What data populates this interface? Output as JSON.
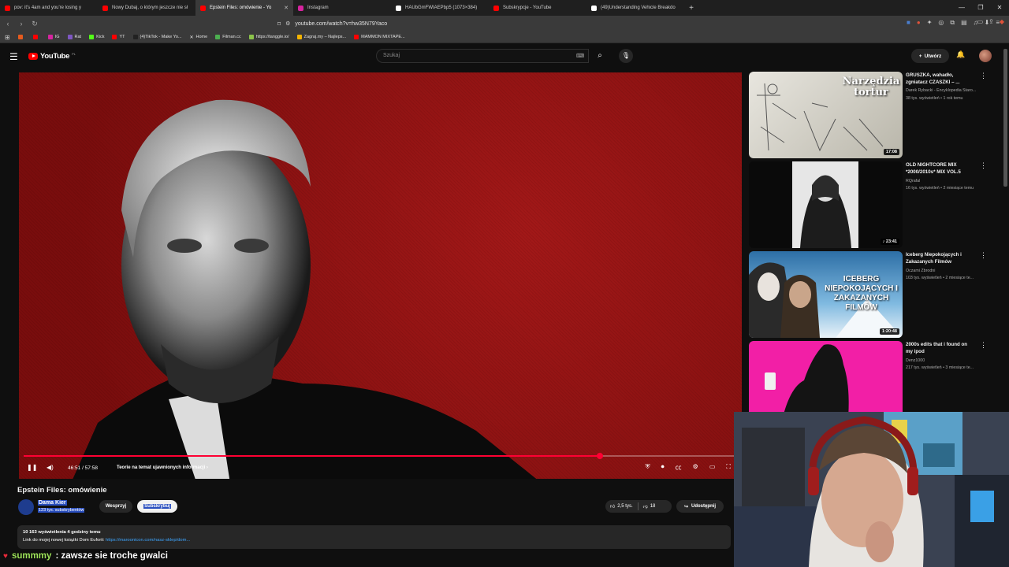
{
  "browser": {
    "tabs": [
      {
        "title": "pov: it's 4am and you're losing y",
        "color": "#ff0000",
        "active": false
      },
      {
        "title": "Nowy Dubaj, o którym jeszcze nie sł",
        "color": "#ff0000",
        "active": false
      },
      {
        "title": "Epstein Files: omówienie - Yo",
        "color": "#ff0000",
        "active": true
      },
      {
        "title": "Instagram",
        "color": "#d6249f",
        "active": false
      },
      {
        "title": "HAUbGmFWIAEPbp5 (1073×384)",
        "color": "#ffffff",
        "active": false
      },
      {
        "title": "Subskrypcje - YouTube",
        "color": "#ff0000",
        "active": false
      },
      {
        "title": "(49)Understanding Vehicle Breakdo",
        "color": "#ffffff",
        "active": false
      }
    ],
    "url": "youtube.com/watch?v=hw35N79Yaco",
    "bookmarks": [
      {
        "label": "",
        "color": "#e65b1e"
      },
      {
        "label": "",
        "color": "#ff0000"
      },
      {
        "label": "IG",
        "color": "#d6249f"
      },
      {
        "label": "Rat",
        "color": "#7e57c2"
      },
      {
        "label": "Kick",
        "color": "#53fc18"
      },
      {
        "label": "YT",
        "color": "#ff0000"
      },
      {
        "label": "(4)TikTok - Make Yo...",
        "color": "#222222"
      },
      {
        "label": "Home",
        "color": "#ffffff"
      },
      {
        "label": "Filman.cc",
        "color": "#4caf50"
      },
      {
        "label": "https://tanggle.io/",
        "color": "#8bc34a"
      },
      {
        "label": "Zagraj.my – Najleps...",
        "color": "#f4b400"
      },
      {
        "label": "MAMMON MIXTAPE...",
        "color": "#ff0000"
      }
    ]
  },
  "youtube": {
    "logo_text": "YouTube",
    "logo_region": "PL",
    "search_placeholder": "Szukaj",
    "create_label": "Utwórz"
  },
  "player": {
    "current_time": "46:51",
    "duration": "57:58",
    "time_display": "46:51 / 57:58",
    "progress_fraction": 0.808,
    "chapter": "Teorie na temat ujawnionych informacji"
  },
  "video": {
    "title": "Epstein Files: omówienie",
    "channel": "Dama Kier",
    "subscribers": "123 tys. subskrybentów",
    "support_label": "Wesprzyj",
    "subscribe_label": "Subskrybuj",
    "likes": "2,5 tys.",
    "dislikes": "18",
    "share_label": "Udostępnij",
    "views_date": "10 163 wyświetlenia  4 godziny temu",
    "description_prefix": "Link do mojej nowej książki Dom Euforii: ",
    "description_link": "https://maroonicon.com/nasz-sklep/dom..."
  },
  "recommendations": [
    {
      "title": "GRUSZKA, wahadło, zgniatacz CZASZKI – ...",
      "channel": "Darek Rybacki - Encyklopedia Staro...",
      "meta": "38 tys. wyświetleń • 1 rok temu",
      "duration": "17:08",
      "thumb_text": "Narzędzia tortur"
    },
    {
      "title": "OLD NIGHTCORE MIX *2000/2010s* MIX VOL.5",
      "channel": "RQrafal",
      "meta": "16 tys. wyświetleń • 2 miesiące temu",
      "duration": "♪ 23:41",
      "thumb_text": ""
    },
    {
      "title": "Iceberg Niepokojących i Zakazanych Filmów",
      "channel": "Oczami Zbrodni",
      "meta": "103 tys. wyświetleń • 2 miesiące te...",
      "duration": "1:20:48",
      "thumb_text": "ICEBERG NIEPOKOJĄCYCH I ZAKAZANYCH FILMÓW"
    },
    {
      "title": "2000s edits that i found on my ipod",
      "channel": "Denz1000",
      "meta": "217 tys. wyświetleń • 3 miesiące te...",
      "duration": "",
      "thumb_text": ""
    }
  ],
  "chat": {
    "user": "summmy",
    "message": ": zawsze sie troche gwalci"
  }
}
